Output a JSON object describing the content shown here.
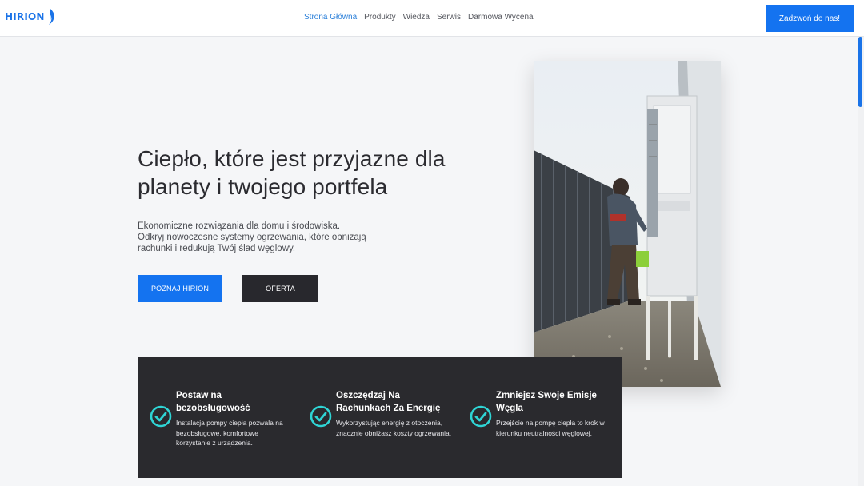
{
  "header": {
    "logo_text": "HIRION",
    "nav": [
      {
        "label": "Strona Główna",
        "active": true
      },
      {
        "label": "Produkty",
        "active": false
      },
      {
        "label": "Wiedza",
        "active": false
      },
      {
        "label": "Serwis",
        "active": false
      },
      {
        "label": "Darmowa Wycena",
        "active": false
      }
    ],
    "call_button": "Zadzwoń do nas!"
  },
  "hero": {
    "title_line1": "Ciepło, które jest przyjazne dla",
    "title_line2": "planety i twojego portfela",
    "desc_line1": "Ekonomiczne rozwiązania dla domu i środowiska.",
    "desc_line2": "Odkryj nowoczesne systemy ogrzewania, które obniżają",
    "desc_line3": "rachunki i redukują Twój ślad węglowy.",
    "primary_button": "POZNAJ HIRION",
    "secondary_button": "OFERTA"
  },
  "features": [
    {
      "title_line1": "Postaw na",
      "title_line2": "bezobsługowość",
      "text_line1": "Instalacja pompy ciepła pozwala na",
      "text_line2": "bezobsługowe, komfortowe",
      "text_line3": "korzystanie z urządzenia."
    },
    {
      "title_line1": "Oszczędzaj Na",
      "title_line2": "Rachunkach Za Energię",
      "text_line1": "Wykorzystując energię z otoczenia,",
      "text_line2": "znacznie obniżasz koszty ogrzewania.",
      "text_line3": ""
    },
    {
      "title_line1": "Zmniejsz Swoje Emisje",
      "title_line2": "Węgla",
      "text_line1": "Przejście na pompę ciepła to krok w",
      "text_line2": "kierunku neutralności węglowej.",
      "text_line3": ""
    }
  ],
  "colors": {
    "accent": "#1473f0",
    "dark_panel": "#2a2a2e",
    "check_icon": "#2fd4d4"
  },
  "icons": {
    "logo": "flame-icon",
    "feature_check": "check-circle-icon"
  }
}
